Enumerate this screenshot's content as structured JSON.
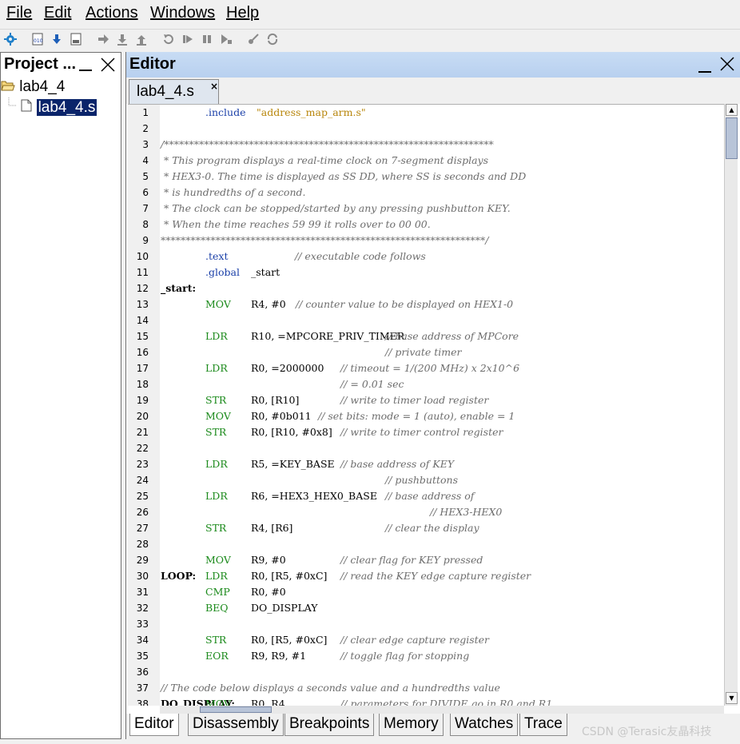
{
  "menu": [
    "File",
    "Edit",
    "Actions",
    "Windows",
    "Help"
  ],
  "toolbar_icons": [
    "settings-gear-icon",
    "compile-icon",
    "download-icon",
    "compile-load-icon",
    "step-into-icon",
    "step-over-icon",
    "step-out-icon",
    "restart-icon",
    "continue-icon",
    "pause-icon",
    "run-to-cursor-icon",
    "breakpoint-icon",
    "refresh-icon"
  ],
  "project": {
    "title": "Project ...",
    "tree": {
      "root": "lab4_4",
      "file": "lab4_4.s"
    }
  },
  "editor": {
    "title": "Editor",
    "tab_label": "lab4_4.s",
    "tab_close": "×"
  },
  "code": [
    {
      "n": "1",
      "label": "",
      "instr": "",
      "dir": ".include",
      "ops": "\"address_map_arm.s\"",
      "cmt": ""
    },
    {
      "n": "2",
      "label": "",
      "instr": "",
      "dir": "",
      "ops": "",
      "cmt": ""
    },
    {
      "n": "3",
      "label": "",
      "instr": "",
      "dir": "",
      "ops": "",
      "cmt": "/******************************************************************"
    },
    {
      "n": "4",
      "label": "",
      "instr": "",
      "dir": "",
      "ops": "",
      "cmt": " * This program displays a real-time clock on 7-segment displays"
    },
    {
      "n": "5",
      "label": "",
      "instr": "",
      "dir": "",
      "ops": "",
      "cmt": " * HEX3-0. The time is displayed as SS DD, where SS is seconds and DD"
    },
    {
      "n": "6",
      "label": "",
      "instr": "",
      "dir": "",
      "ops": "",
      "cmt": " * is hundredths of a second."
    },
    {
      "n": "7",
      "label": "",
      "instr": "",
      "dir": "",
      "ops": "",
      "cmt": " * The clock can be stopped/started by any pressing pushbutton KEY."
    },
    {
      "n": "8",
      "label": "",
      "instr": "",
      "dir": "",
      "ops": "",
      "cmt": " * When the time reaches 59 99 it rolls over to 00 00."
    },
    {
      "n": "9",
      "label": "",
      "instr": "",
      "dir": "",
      "ops": "",
      "cmt": "*****************************************************************/"
    },
    {
      "n": "10",
      "label": "",
      "instr": "",
      "dir": ".text",
      "ops": "",
      "cmt": "// executable code follows"
    },
    {
      "n": "11",
      "label": "",
      "instr": "",
      "dir": ".global",
      "ops": "_start",
      "cmt": ""
    },
    {
      "n": "12",
      "label": "_start:",
      "instr": "",
      "dir": "",
      "ops": "",
      "cmt": ""
    },
    {
      "n": "13",
      "label": "",
      "instr": "MOV",
      "dir": "",
      "ops": "R4, #0",
      "cmt": "// counter value to be displayed on HEX1-0"
    },
    {
      "n": "14",
      "label": "",
      "instr": "",
      "dir": "",
      "ops": "",
      "cmt": ""
    },
    {
      "n": "15",
      "label": "",
      "instr": "LDR",
      "dir": "",
      "ops": "R10, =MPCORE_PRIV_TIMER",
      "cmt": "// base address of MPCore"
    },
    {
      "n": "16",
      "label": "",
      "instr": "",
      "dir": "",
      "ops": "",
      "cmt": "// private timer"
    },
    {
      "n": "17",
      "label": "",
      "instr": "LDR",
      "dir": "",
      "ops": "R0, =2000000",
      "cmt": "// timeout = 1/(200 MHz) x 2x10^6"
    },
    {
      "n": "18",
      "label": "",
      "instr": "",
      "dir": "",
      "ops": "",
      "cmt": "// = 0.01 sec"
    },
    {
      "n": "19",
      "label": "",
      "instr": "STR",
      "dir": "",
      "ops": "R0, [R10]",
      "cmt": "// write to timer load register"
    },
    {
      "n": "20",
      "label": "",
      "instr": "MOV",
      "dir": "",
      "ops": "R0, #0b011",
      "cmt": "// set bits: mode = 1 (auto), enable = 1"
    },
    {
      "n": "21",
      "label": "",
      "instr": "STR",
      "dir": "",
      "ops": "R0, [R10, #0x8]",
      "cmt": "// write to timer control register"
    },
    {
      "n": "22",
      "label": "",
      "instr": "",
      "dir": "",
      "ops": "",
      "cmt": ""
    },
    {
      "n": "23",
      "label": "",
      "instr": "LDR",
      "dir": "",
      "ops": "R5, =KEY_BASE",
      "cmt": "// base address of KEY"
    },
    {
      "n": "24",
      "label": "",
      "instr": "",
      "dir": "",
      "ops": "",
      "cmt": "// pushbuttons"
    },
    {
      "n": "25",
      "label": "",
      "instr": "LDR",
      "dir": "",
      "ops": "R6, =HEX3_HEX0_BASE",
      "cmt": "// base address of"
    },
    {
      "n": "26",
      "label": "",
      "instr": "",
      "dir": "",
      "ops": "",
      "cmt": "// HEX3-HEX0"
    },
    {
      "n": "27",
      "label": "",
      "instr": "STR",
      "dir": "",
      "ops": "R4, [R6]",
      "cmt": "// clear the display"
    },
    {
      "n": "28",
      "label": "",
      "instr": "",
      "dir": "",
      "ops": "",
      "cmt": ""
    },
    {
      "n": "29",
      "label": "",
      "instr": "MOV",
      "dir": "",
      "ops": "R9, #0",
      "cmt": "// clear flag for KEY pressed"
    },
    {
      "n": "30",
      "label": "LOOP:",
      "instr": "LDR",
      "dir": "",
      "ops": "R0, [R5, #0xC]",
      "cmt": "// read the KEY edge capture register"
    },
    {
      "n": "31",
      "label": "",
      "instr": "CMP",
      "dir": "",
      "ops": "R0, #0",
      "cmt": ""
    },
    {
      "n": "32",
      "label": "",
      "instr": "BEQ",
      "dir": "",
      "ops": "DO_DISPLAY",
      "cmt": ""
    },
    {
      "n": "33",
      "label": "",
      "instr": "",
      "dir": "",
      "ops": "",
      "cmt": ""
    },
    {
      "n": "34",
      "label": "",
      "instr": "STR",
      "dir": "",
      "ops": "R0, [R5, #0xC]",
      "cmt": "// clear edge capture register"
    },
    {
      "n": "35",
      "label": "",
      "instr": "EOR",
      "dir": "",
      "ops": "R9, R9, #1",
      "cmt": "// toggle flag for stopping"
    },
    {
      "n": "36",
      "label": "",
      "instr": "",
      "dir": "",
      "ops": "",
      "cmt": ""
    },
    {
      "n": "37",
      "label": "",
      "instr": "",
      "dir": "",
      "ops": "",
      "cmt": "// The code below displays a seconds value and a hundredths value"
    },
    {
      "n": "38",
      "label": "DO_DISPLAY:",
      "instr": "MOV",
      "dir": "",
      "ops": "R0, R4",
      "cmt": "// parameters for DIVIDE go in R0 and R1"
    }
  ],
  "bottom_tabs": [
    "Editor",
    "Disassembly",
    "Breakpoints",
    "Memory",
    "Watches",
    "Trace"
  ],
  "watermark": "CSDN @Terasic友晶科技",
  "colors": {
    "instr": "#1b8a1b",
    "directive": "#1a3fa8",
    "comment": "#6d6d6d",
    "string": "#b8860b",
    "selection": "#0a246a",
    "editor_header": "#c8dcf4"
  }
}
